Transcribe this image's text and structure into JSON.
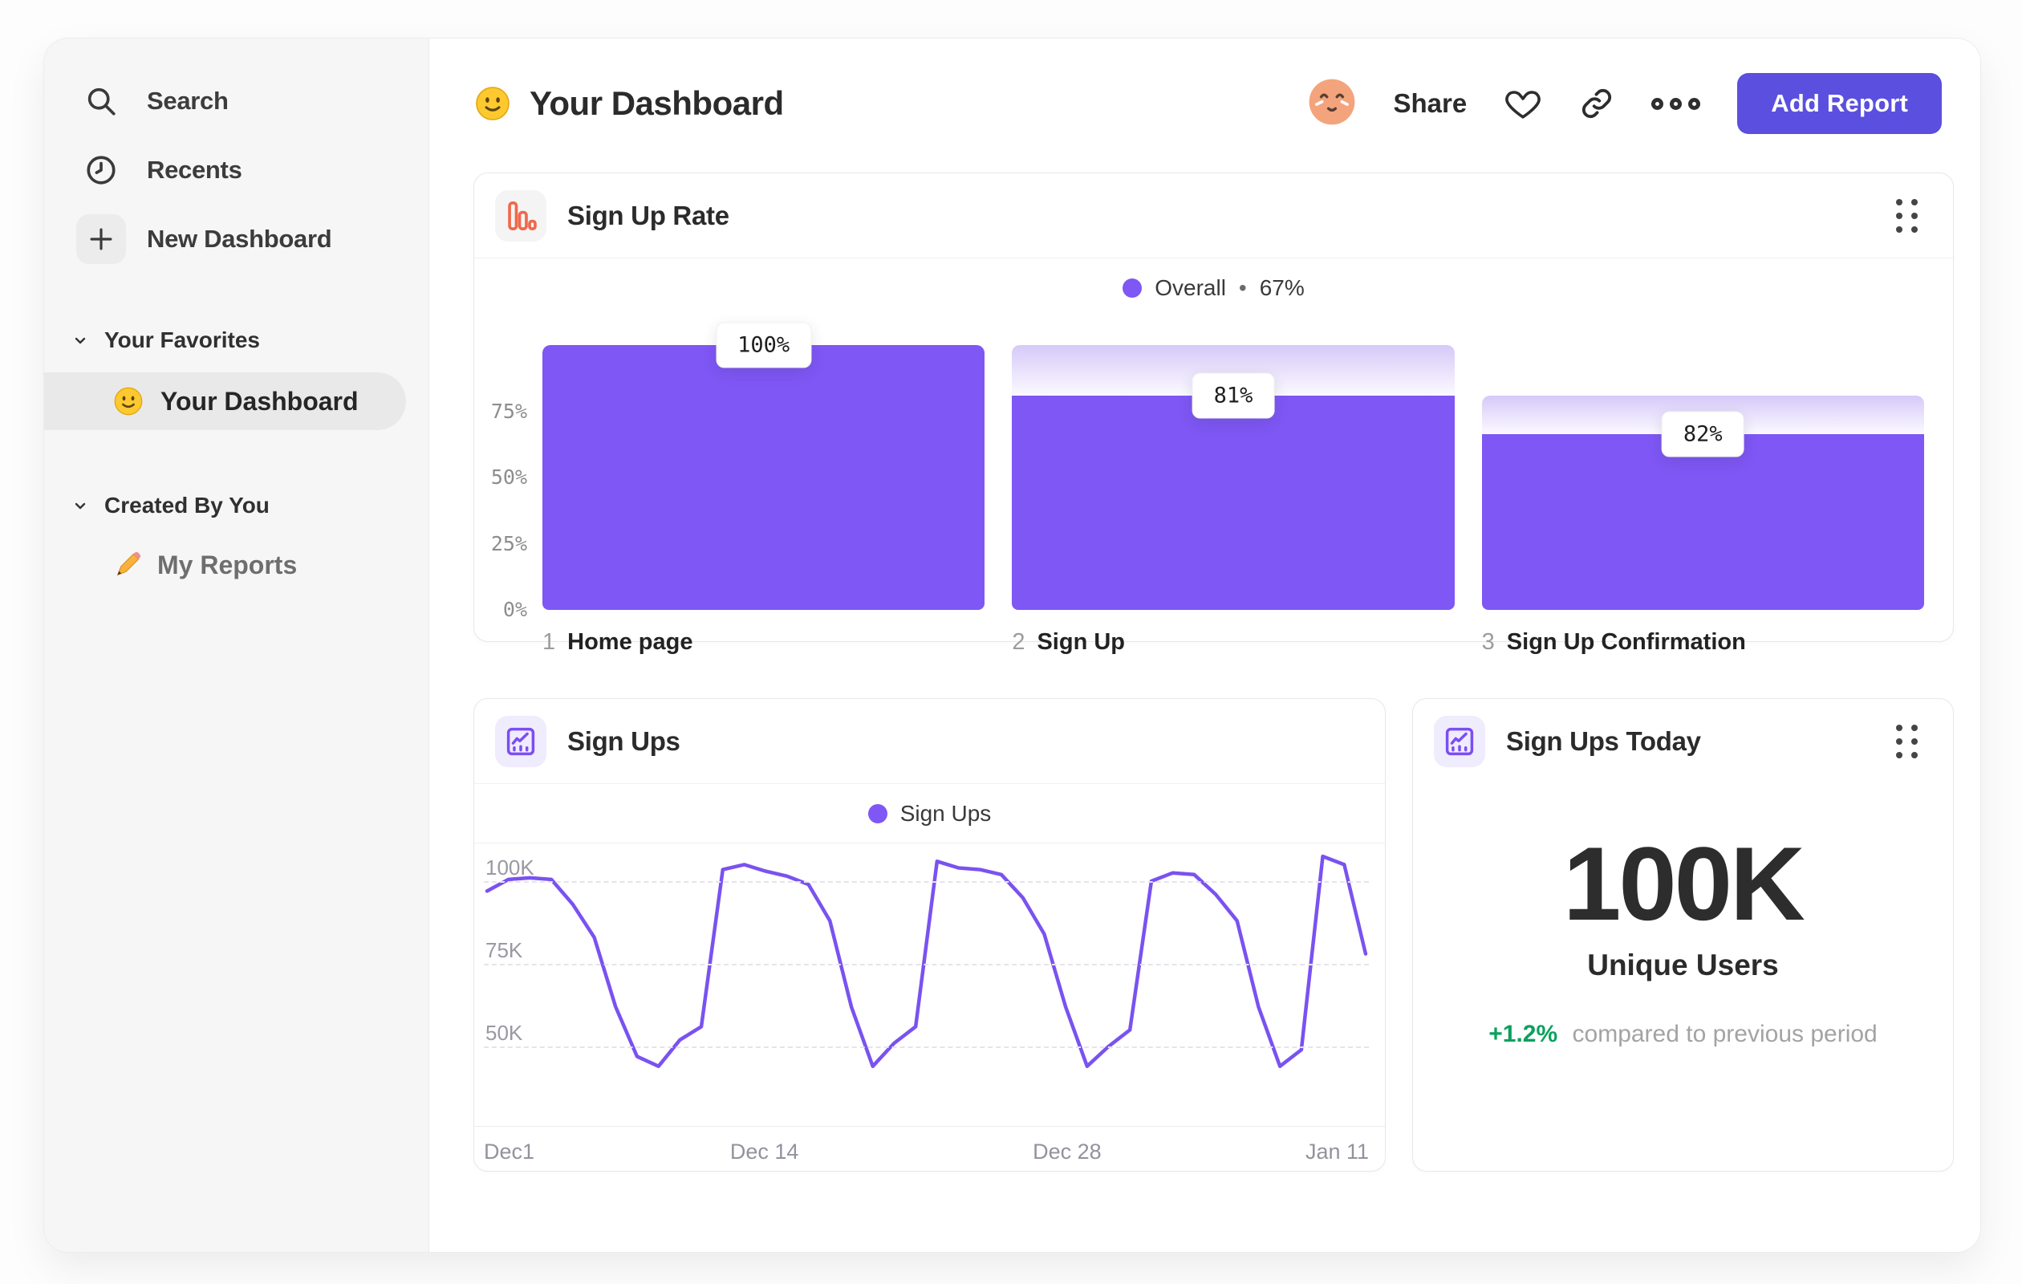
{
  "header": {
    "title": "Your Dashboard",
    "share_label": "Share",
    "add_report_label": "Add Report"
  },
  "sidebar": {
    "items": [
      {
        "label": "Search"
      },
      {
        "label": "Recents"
      },
      {
        "label": "New Dashboard"
      }
    ],
    "sections": [
      {
        "title": "Your Favorites",
        "items": [
          {
            "label": "Your Dashboard",
            "active": true
          }
        ]
      },
      {
        "title": "Created By You",
        "items": [
          {
            "label": "My Reports",
            "active": false
          }
        ]
      }
    ]
  },
  "icons": {
    "title_emoji": "slightly-smiling-face",
    "favorites_item_emoji": "slightly-smiling-face",
    "reports_item_emoji": "pencil",
    "funnel_card_icon": "bar-chart",
    "line_card_icon": "line-chart",
    "stat_card_icon": "line-chart"
  },
  "cards": {
    "funnel": {
      "title": "Sign Up Rate",
      "legend_label": "Overall",
      "legend_sep": "•",
      "legend_value": "67%",
      "y_ticks": [
        {
          "label": "75%",
          "value": 75
        },
        {
          "label": "50%",
          "value": 50
        },
        {
          "label": "25%",
          "value": 25
        },
        {
          "label": "0%",
          "value": 0
        }
      ],
      "steps": [
        {
          "num": "1",
          "label": "Home page",
          "pct_label": "100%"
        },
        {
          "num": "2",
          "label": "Sign Up",
          "pct_label": "81%"
        },
        {
          "num": "3",
          "label": "Sign Up Confirmation",
          "pct_label": "82%"
        }
      ]
    },
    "line": {
      "title": "Sign Ups",
      "legend_label": "Sign Ups",
      "y_ticks": [
        {
          "label": "100K",
          "value": 100
        },
        {
          "label": "75K",
          "value": 75
        },
        {
          "label": "50K",
          "value": 50
        }
      ],
      "x_ticks": [
        {
          "label": "Dec1",
          "pos": 0
        },
        {
          "label": "Dec 14",
          "pos": 0.317
        },
        {
          "label": "Dec 28",
          "pos": 0.659
        },
        {
          "label": "Jan 11",
          "pos": 1
        }
      ]
    },
    "stat": {
      "title": "Sign Ups Today",
      "value": "100K",
      "unit_label": "Unique Users",
      "delta": "+1.2%",
      "delta_caption": "compared to previous period"
    }
  },
  "chart_data": [
    {
      "type": "bar",
      "subtype": "funnel",
      "title": "Sign Up Rate",
      "categories": [
        "1 Home page",
        "2 Sign Up",
        "3 Sign Up Confirmation"
      ],
      "step_conversion_pct": [
        100,
        81,
        82
      ],
      "cumulative_pct": [
        100,
        81,
        66.4
      ],
      "overall_conversion_pct": 67,
      "ylim": [
        0,
        100
      ],
      "y_tick_labels": [
        "0%",
        "25%",
        "50%",
        "75%"
      ],
      "legend": [
        "Overall"
      ],
      "legend_position": "top-center",
      "grid": false
    },
    {
      "type": "line",
      "title": "Sign Ups",
      "x_tick_labels": [
        "Dec1",
        "Dec 14",
        "Dec 28",
        "Jan 11"
      ],
      "y_tick_labels": [
        "50K",
        "75K",
        "100K"
      ],
      "grid": "dashed-horizontal",
      "legend": [
        "Sign Ups"
      ],
      "legend_position": "top-center",
      "series": [
        {
          "name": "Sign Ups",
          "unit": "thousands",
          "values": [
            97,
            100.5,
            101,
            100.5,
            93,
            83,
            62,
            47,
            44,
            52,
            56,
            103.5,
            105,
            103,
            101.5,
            99,
            88,
            62,
            44,
            51,
            56,
            106,
            104,
            103.5,
            102,
            95,
            84,
            62,
            44,
            50,
            55,
            100,
            102.5,
            102,
            96,
            88,
            62,
            44,
            49,
            107.5,
            105,
            78
          ]
        }
      ]
    }
  ],
  "colors": {
    "accent_purple": "#7E57F5",
    "bar_gradient_top": "#D5C9F8",
    "button_indigo": "#5A4FDF",
    "positive_green": "#0BA15E",
    "icon_orange": "#F0684B",
    "sidebar_bg": "#F6F6F6",
    "card_border": "#E7E7E7",
    "text_dark": "#2B2B2B",
    "text_gray": "#9A9A9A"
  }
}
